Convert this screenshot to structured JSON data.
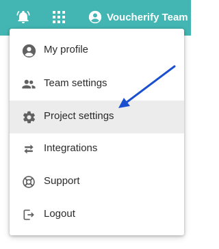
{
  "topbar": {
    "background": "#43b6b3",
    "icons": [
      "bell-icon",
      "apps-grid-icon",
      "account-circle-icon"
    ],
    "account_name": "Voucherify Team"
  },
  "menu": {
    "items": [
      {
        "label": "My profile",
        "icon": "account-circle-icon"
      },
      {
        "label": "Team settings",
        "icon": "people-icon"
      },
      {
        "label": "Project settings",
        "icon": "gear-icon",
        "highlighted": true
      },
      {
        "label": "Integrations",
        "icon": "swap-arrows-icon"
      },
      {
        "label": "Support",
        "icon": "lifebuoy-icon"
      },
      {
        "label": "Logout",
        "icon": "logout-icon"
      }
    ]
  },
  "annotation": {
    "type": "arrow",
    "color": "#1a4fd0",
    "points_to": "Project settings"
  }
}
